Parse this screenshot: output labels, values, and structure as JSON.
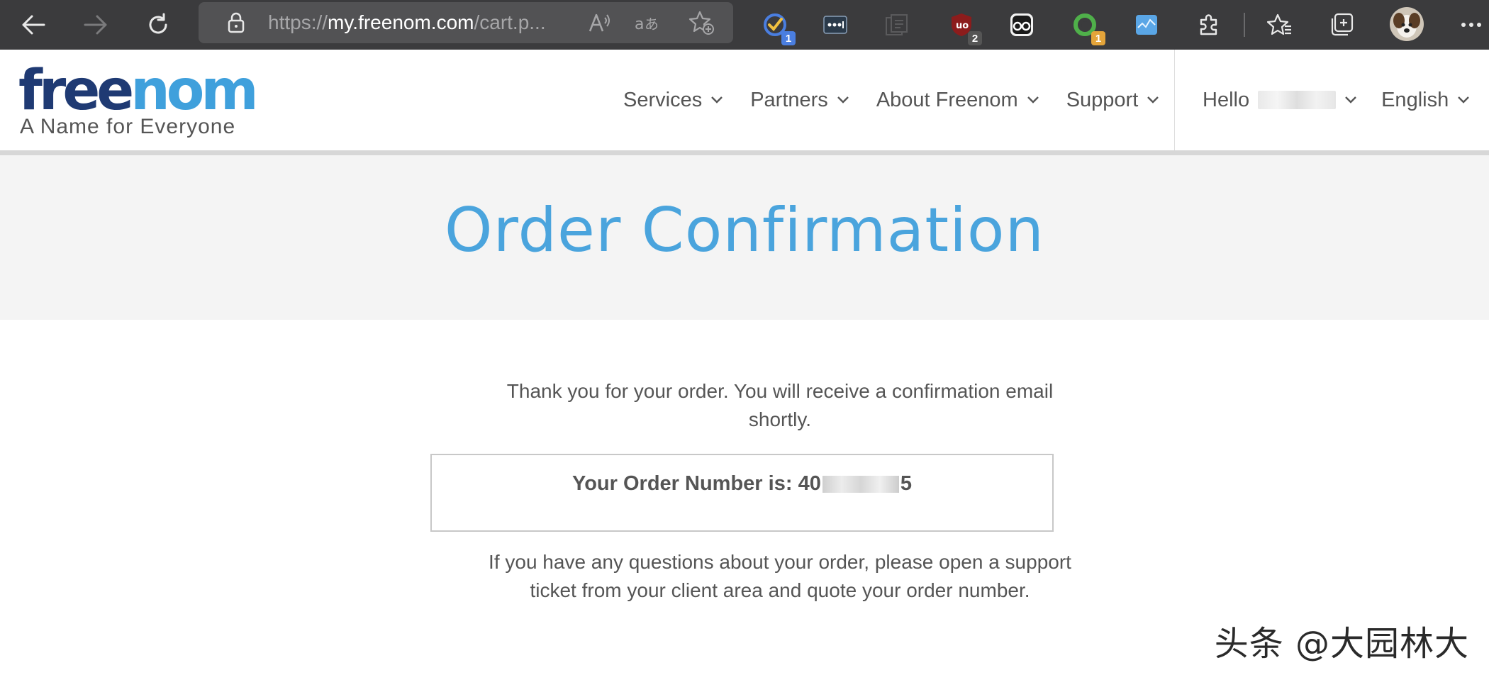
{
  "browser": {
    "url_scheme": "https://",
    "url_host": "my.freenom.com",
    "url_path": "/cart.p...",
    "extensions": [
      {
        "name": "task-check-extension",
        "badge": "1",
        "badge_color": "#4a7ee0"
      },
      {
        "name": "dots-extension",
        "badge": "",
        "badge_color": ""
      },
      {
        "name": "notes-extension",
        "badge": "",
        "badge_color": ""
      },
      {
        "name": "ublock-extension",
        "badge": "2",
        "badge_color": "#555555"
      },
      {
        "name": "spy-extension",
        "badge": "",
        "badge_color": ""
      },
      {
        "name": "green-circle-extension",
        "badge": "1",
        "badge_color": "#e4a43a"
      },
      {
        "name": "chart-extension",
        "badge": "",
        "badge_color": ""
      }
    ]
  },
  "site": {
    "logo_part1": "free",
    "logo_part2": "nom",
    "tagline": "A Name for Everyone",
    "nav": {
      "services": "Services",
      "partners": "Partners",
      "about": "About Freenom",
      "support": "Support",
      "hello": "Hello",
      "language": "English"
    }
  },
  "hero": {
    "title": "Order Confirmation"
  },
  "content": {
    "thank_you_line1": "Thank you for your order. You will receive a confirmation email",
    "thank_you_line2": "shortly.",
    "order_label": "Your Order Number is:",
    "order_prefix": "40",
    "order_suffix": "5",
    "questions_line1": "If you have any questions about your order, please open a support",
    "questions_line2": "ticket from your client area and quote your order number."
  },
  "watermark": "头条 @大园林大",
  "colors": {
    "brand_dark": "#1f3a73",
    "brand_blue": "#3fa0dc",
    "title_blue": "#4aa4dd",
    "toolbar_bg": "#3b3b3d"
  }
}
